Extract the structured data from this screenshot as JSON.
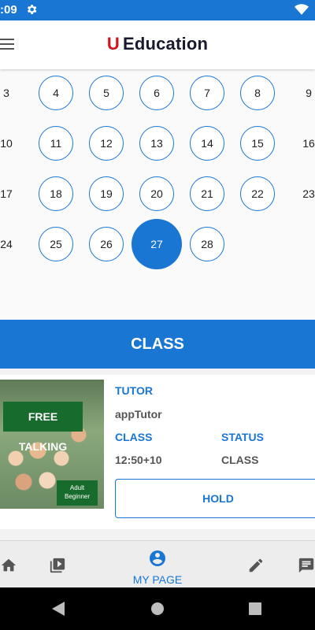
{
  "status_bar": {
    "time": ":09"
  },
  "app_bar": {
    "brand_u": "U",
    "brand_name": "Education"
  },
  "calendar": {
    "rows": [
      {
        "left": "3",
        "days": [
          "4",
          "5",
          "6",
          "7",
          "8"
        ],
        "right": "9"
      },
      {
        "left": "10",
        "days": [
          "11",
          "12",
          "13",
          "14",
          "15"
        ],
        "right": "16"
      },
      {
        "left": "17",
        "days": [
          "18",
          "19",
          "20",
          "21",
          "22"
        ],
        "right": "23"
      },
      {
        "left": "24",
        "days": [
          "25",
          "26",
          "27",
          "28"
        ],
        "right": ""
      }
    ],
    "selected_day": "27"
  },
  "class_header": "CLASS",
  "lesson_card": {
    "thumbnail_title": "FREE TALKING",
    "thumbnail_level_1": "Adult",
    "thumbnail_level_2": "Beginner",
    "tutor_label": "TUTOR",
    "tutor_value": "appTutor",
    "class_label": "CLASS",
    "class_value": "12:50+10",
    "status_label": "STATUS",
    "status_value": "CLASS",
    "hold_button": "HOLD"
  },
  "bottom_nav": {
    "items": [
      {
        "icon": "home-icon"
      },
      {
        "icon": "video-library-icon"
      },
      {
        "icon": "account-circle-icon",
        "label": "MY PAGE",
        "active": true
      },
      {
        "icon": "edit-icon"
      },
      {
        "icon": "chat-icon"
      }
    ]
  },
  "colors": {
    "primary": "#1976d2",
    "brand_red": "#d4121b"
  }
}
